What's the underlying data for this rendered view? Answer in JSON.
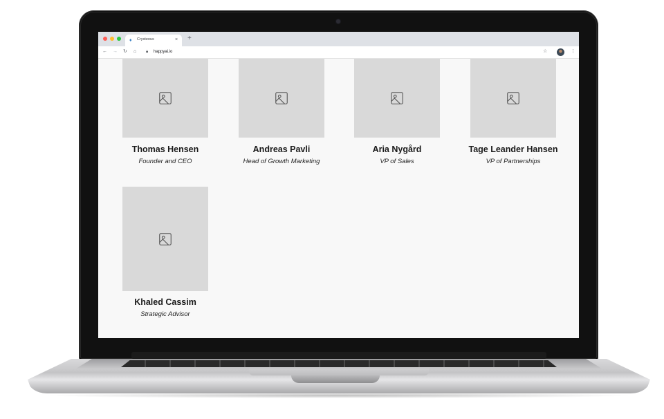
{
  "browser": {
    "tab_title": "Crysteous",
    "tab_close": "×",
    "new_tab": "+",
    "url": "happyai.io",
    "icons": [
      "back-icon",
      "forward-icon",
      "reload-icon",
      "home-icon",
      "lock-icon",
      "star-icon",
      "profile-avatar",
      "menu-icon"
    ]
  },
  "team": [
    {
      "name": "Thomas Hensen",
      "role": "Founder and CEO"
    },
    {
      "name": "Andreas Pavli",
      "role": "Head of Growth Marketing"
    },
    {
      "name": "Aria Nygård",
      "role": "VP of Sales"
    },
    {
      "name": "Tage Leander Hansen",
      "role": "VP of Partnerships"
    },
    {
      "name": "Khaled Cassim",
      "role": "Strategic Advisor"
    }
  ],
  "colors": {
    "photo_placeholder": "#d9d9d9",
    "page_background": "#f8f8f8",
    "tabbar": "#dee1e6"
  }
}
